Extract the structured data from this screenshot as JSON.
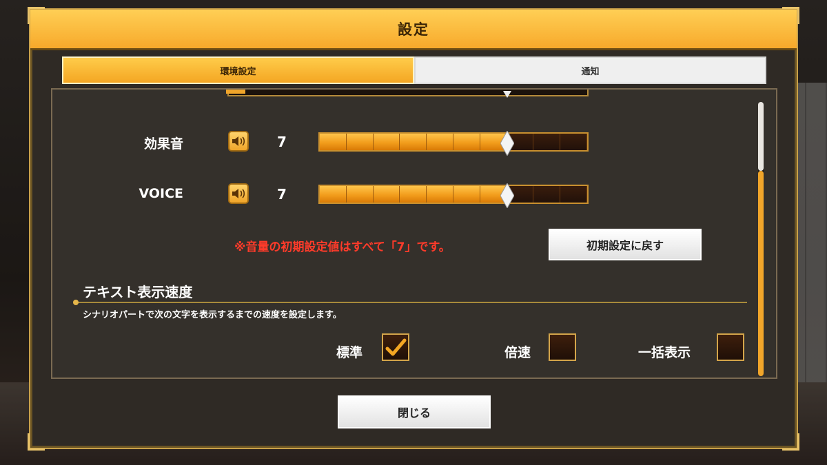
{
  "dialog": {
    "title": "設定"
  },
  "tabs": [
    {
      "label": "環境設定",
      "active": true
    },
    {
      "label": "通知",
      "active": false
    }
  ],
  "volume_rows": [
    {
      "label": "効果音",
      "value": "7",
      "level": 7,
      "max": 10,
      "icon": "speaker-icon"
    },
    {
      "label": "VOICE",
      "value": "7",
      "level": 7,
      "max": 10,
      "icon": "speaker-icon"
    }
  ],
  "volume_note": "※音量の初期設定値はすべて「7」です。",
  "reset_button": "初期設定に戻す",
  "text_speed": {
    "title": "テキスト表示速度",
    "description": "シナリオパートで次の文字を表示するまでの速度を設定します。",
    "options": [
      {
        "label": "標準",
        "checked": true
      },
      {
        "label": "倍速",
        "checked": false
      },
      {
        "label": "一括表示",
        "checked": false
      }
    ]
  },
  "close_button": "閉じる",
  "colors": {
    "accent": "#f4a623",
    "warning": "#ff3b2a",
    "frame": "#c9a14a"
  }
}
